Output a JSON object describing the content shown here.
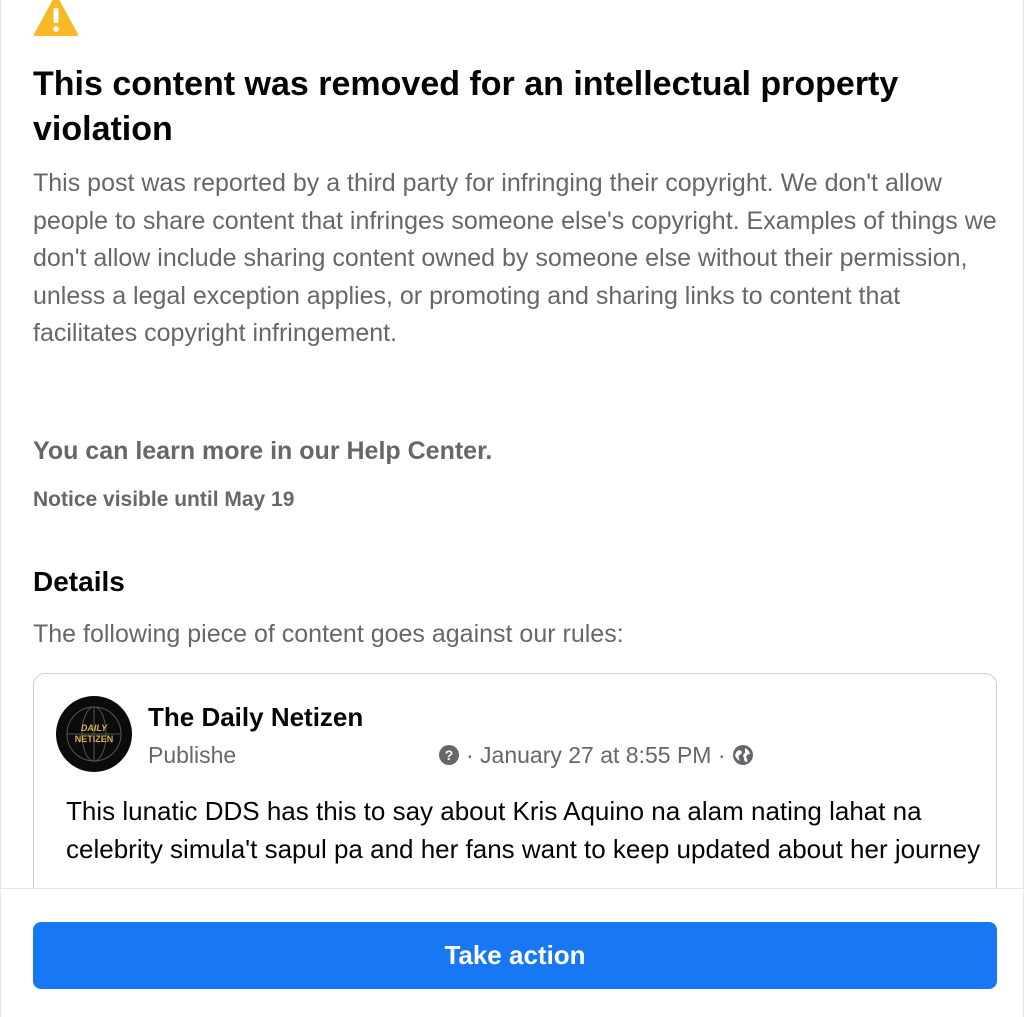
{
  "notice": {
    "title": "This content was removed for an intellectual property violation",
    "body": "This post was reported by a third party for infringing their copyright. We don't allow people to share content that infringes someone else's copyright. Examples of things we don't allow include sharing content owned by someone else without their permission, unless a legal exception applies, or promoting and sharing links to content that facilitates copyright infringement.",
    "help_text": "You can learn more in our Help Center.",
    "visible_until": "Notice visible until May 19"
  },
  "details": {
    "heading": "Details",
    "subheading": "The following piece of content goes against our rules:"
  },
  "post": {
    "page_name": "The Daily Netizen",
    "avatar_text_line1": "DAILY",
    "avatar_text_line2": "NETIZEN",
    "published_label": "Publishe",
    "timestamp": "· January 27 at 8:55 PM ·",
    "audience_icon": "globe-icon",
    "text": "This lunatic DDS has this to say about Kris Aquino na alam nating lahat na celebrity simula't sapul pa and her fans want to keep updated about her journey"
  },
  "actions": {
    "take_action_label": "Take action"
  },
  "colors": {
    "accent": "#1877f2",
    "warning": "#f7b928",
    "primary_text": "#050505",
    "secondary_text": "#65676b"
  }
}
